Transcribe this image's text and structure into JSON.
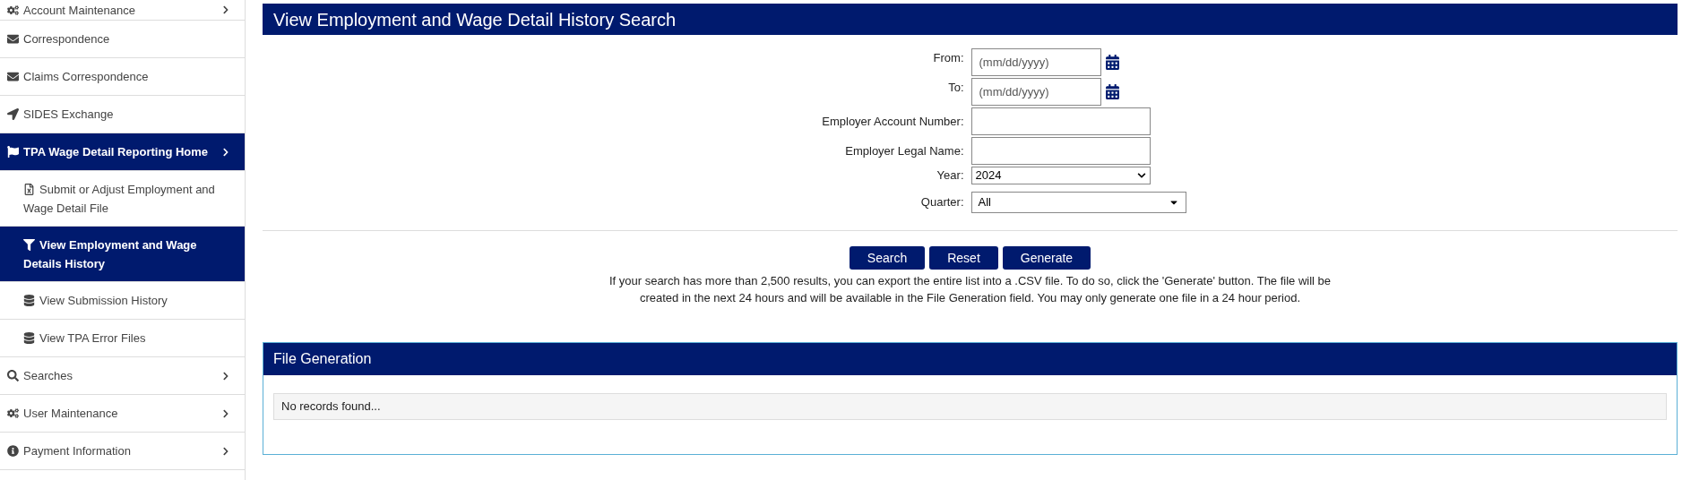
{
  "sidebar": {
    "items": [
      {
        "label": "Account Maintenance",
        "kind": "section",
        "selected": false,
        "expandable": true
      },
      {
        "label": "Correspondence",
        "kind": "section",
        "selected": false,
        "expandable": false
      },
      {
        "label": "Claims Correspondence",
        "kind": "section",
        "selected": false,
        "expandable": false
      },
      {
        "label": "SIDES Exchange",
        "kind": "section",
        "selected": false,
        "expandable": false
      },
      {
        "label": "TPA Wage Detail Reporting Home",
        "kind": "section",
        "selected": true,
        "expandable": true
      },
      {
        "label": "Submit or Adjust Employment and Wage Detail File",
        "kind": "sub",
        "selected": false,
        "expandable": false
      },
      {
        "label": "View Employment and Wage Details History",
        "kind": "sub",
        "selected": true,
        "expandable": false
      },
      {
        "label": "View Submission History",
        "kind": "sub",
        "selected": false,
        "expandable": false
      },
      {
        "label": "View TPA Error Files",
        "kind": "sub",
        "selected": false,
        "expandable": false
      },
      {
        "label": "Searches",
        "kind": "section",
        "selected": false,
        "expandable": true
      },
      {
        "label": "User Maintenance",
        "kind": "section",
        "selected": false,
        "expandable": true
      },
      {
        "label": "Payment Information",
        "kind": "section",
        "selected": false,
        "expandable": true
      }
    ]
  },
  "search_panel": {
    "title": "View Employment and Wage Detail History Search",
    "fields": [
      {
        "label": "From:",
        "kind": "date",
        "placeholder": "(mm/dd/yyyy)"
      },
      {
        "label": "To:",
        "kind": "date",
        "placeholder": "(mm/dd/yyyy)"
      },
      {
        "label": "Employer Account Number:",
        "kind": "text"
      },
      {
        "label": "Employer Legal Name:",
        "kind": "text"
      },
      {
        "label": "Year:",
        "kind": "select",
        "value": "2024"
      },
      {
        "label": "Quarter:",
        "kind": "dropdown",
        "value": "All"
      }
    ],
    "buttons": [
      "Search",
      "Reset",
      "Generate"
    ],
    "note": "If your search has more than 2,500 results, you can export the entire list into a .CSV file. To do so, click the 'Generate' button. The file will be created in the next 24 hours and will be available in the File Generation field. You may only generate one file in a 24 hour period."
  },
  "file_generation": {
    "title": "File Generation",
    "message": "No records found..."
  }
}
